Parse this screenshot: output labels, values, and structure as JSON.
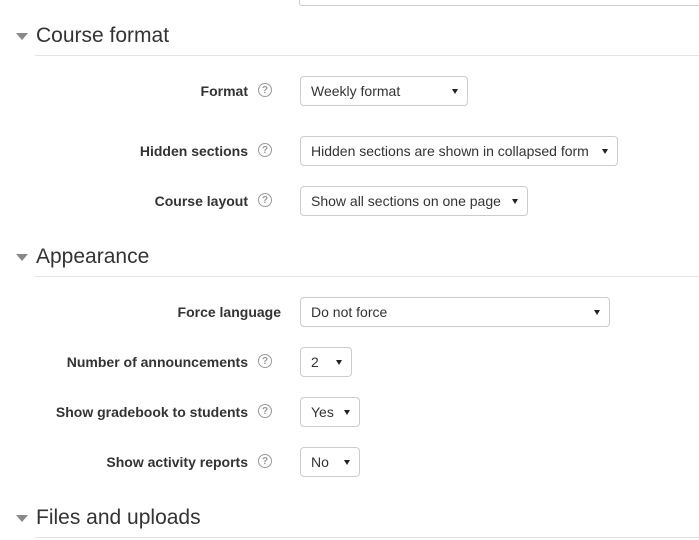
{
  "sections": {
    "course_format": {
      "title": "Course format",
      "fields": {
        "format": {
          "label": "Format",
          "value": "Weekly format"
        },
        "hidden_sections": {
          "label": "Hidden sections",
          "value": "Hidden sections are shown in collapsed form"
        },
        "course_layout": {
          "label": "Course layout",
          "value": "Show all sections on one page"
        }
      }
    },
    "appearance": {
      "title": "Appearance",
      "fields": {
        "force_language": {
          "label": "Force language",
          "value": "Do not force"
        },
        "announcements": {
          "label": "Number of announcements",
          "value": "2"
        },
        "gradebook": {
          "label": "Show gradebook to students",
          "value": "Yes"
        },
        "activity_reports": {
          "label": "Show activity reports",
          "value": "No"
        }
      }
    },
    "files_uploads": {
      "title": "Files and uploads"
    }
  },
  "icons": {
    "help": "question-circle-icon",
    "toggle": "caret-down-icon",
    "dropdown": "dropdown-caret-icon"
  },
  "help_glyph": "?"
}
